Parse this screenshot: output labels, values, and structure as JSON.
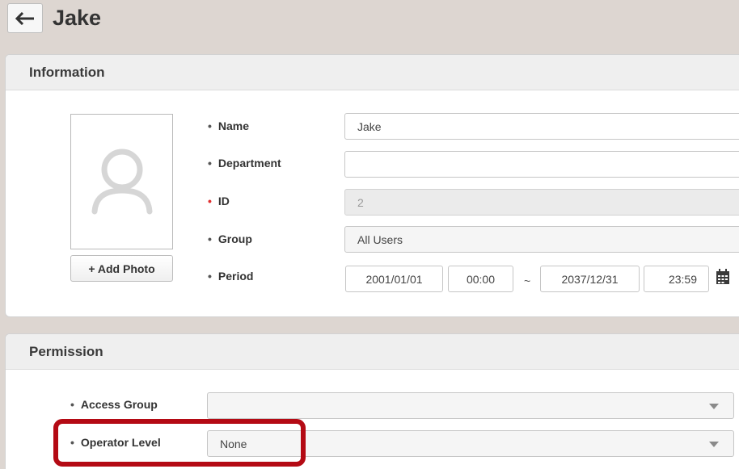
{
  "page": {
    "title": "Jake"
  },
  "information": {
    "title": "Information",
    "add_photo_label": "+ Add Photo",
    "fields": {
      "name": {
        "label": "Name",
        "value": "Jake"
      },
      "department": {
        "label": "Department",
        "value": ""
      },
      "id": {
        "label": "ID",
        "value": "2"
      },
      "group": {
        "label": "Group",
        "value": "All Users"
      },
      "period": {
        "label": "Period",
        "start_date": "2001/01/01",
        "start_time": "00:00",
        "separator": "~",
        "end_date": "2037/12/31",
        "end_time": "23:59"
      }
    }
  },
  "permission": {
    "title": "Permission",
    "fields": {
      "access_group": {
        "label": "Access Group",
        "value": ""
      },
      "operator_level": {
        "label": "Operator Level",
        "value": "None"
      }
    }
  },
  "icons": {
    "back": "arrow-left-icon",
    "avatar": "user-silhouette-icon",
    "calendar": "calendar-icon",
    "dropdown": "caret-down-icon"
  },
  "colors": {
    "highlight": "#b40a14",
    "required_dot": "#e03030",
    "background": "#ddd6d1"
  }
}
